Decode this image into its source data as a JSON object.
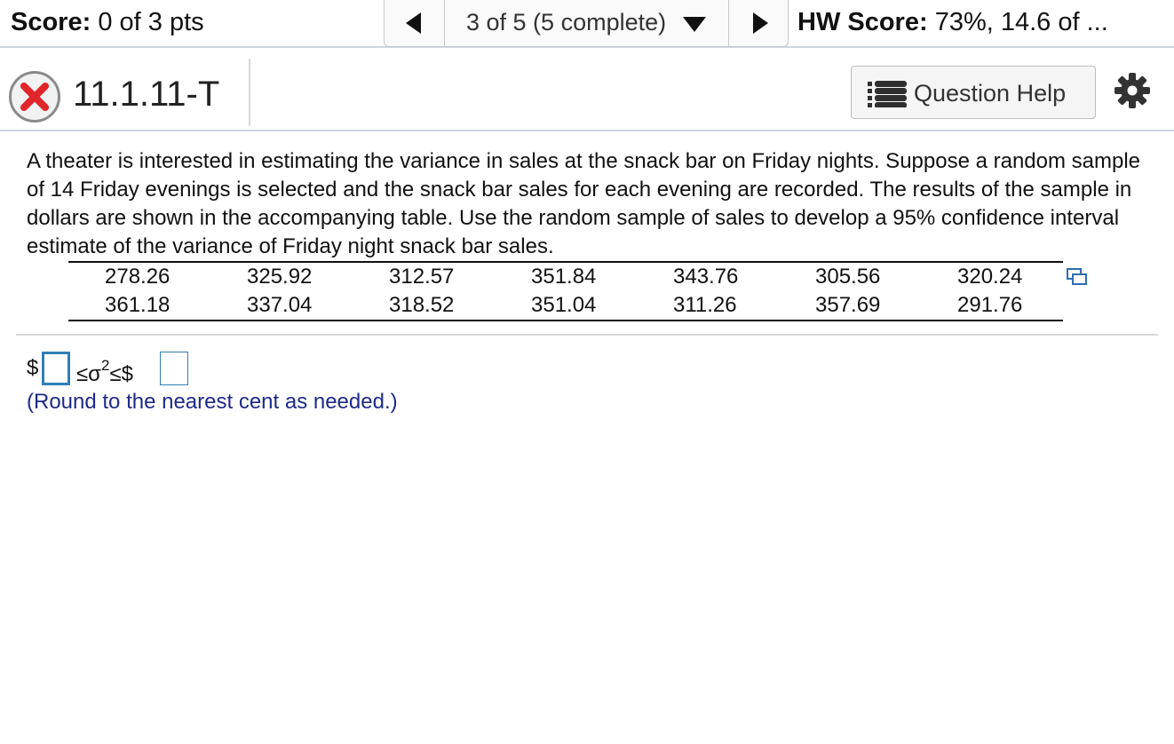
{
  "topbar": {
    "score_label": "Score:",
    "score_value": "0 of 3 pts",
    "question_selector": "3 of 5 (5 complete)",
    "hw_score_label": "HW Score:",
    "hw_score_value": "73%, 14.6 of ..."
  },
  "question": {
    "id": "11.1.11-T",
    "status": "incorrect",
    "help_label": "Question Help",
    "text": "A theater is interested in estimating the variance in sales at the snack bar on Friday nights. Suppose a random sample of 14 Friday evenings is selected and the snack bar sales for each evening are recorded. The results of the sample in dollars are shown in the accompanying table. Use the random sample of sales to develop a 95% confidence interval estimate of the variance of Friday night snack bar sales.",
    "table": [
      [
        "278.26",
        "325.92",
        "312.57",
        "351.84",
        "343.76",
        "305.56",
        "320.24"
      ],
      [
        "361.18",
        "337.04",
        "318.52",
        "351.04",
        "311.26",
        "357.69",
        "291.76"
      ]
    ],
    "answer": {
      "prefix": "$",
      "relation": "≤σ",
      "exponent": "2",
      "relation_end": "≤$",
      "lower_value": "",
      "upper_value": ""
    },
    "note": "(Round to the nearest cent as needed.)"
  },
  "icons": {
    "prev": "triangle-left-icon",
    "next": "triangle-right-icon",
    "dropdown": "triangle-down-icon",
    "status": "incorrect-x-icon",
    "help": "list-icon",
    "settings": "gear-icon",
    "copy": "copy-table-icon"
  },
  "colors": {
    "incorrect": "#e0252b",
    "input_border": "#2e7fb8",
    "note_text": "#1d2a87"
  }
}
